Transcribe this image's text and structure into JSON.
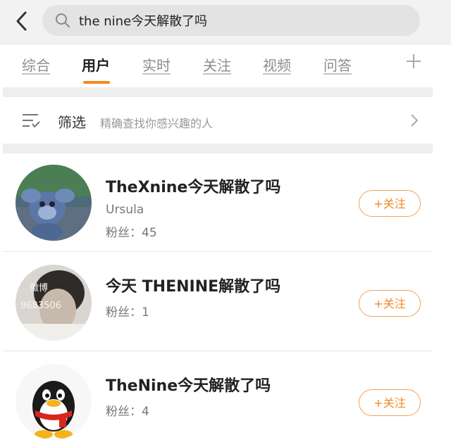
{
  "search": {
    "query": "the nine今天解散了吗"
  },
  "icons": {
    "back": "back-arrow-icon",
    "search": "search-icon",
    "add_tab": "plus-icon",
    "filter": "filter-icon",
    "chevron": "chevron-right-icon"
  },
  "tabs": [
    {
      "label": "综合"
    },
    {
      "label": "用户"
    },
    {
      "label": "实时"
    },
    {
      "label": "关注"
    },
    {
      "label": "视频"
    },
    {
      "label": "问答"
    }
  ],
  "filter": {
    "label": "筛选",
    "hint": "精确查找你感兴趣的人"
  },
  "users": [
    {
      "name": "TheXnine今天解散了吗",
      "subtitle": "Ursula",
      "fans": "粉丝：45",
      "follow": "+关注"
    },
    {
      "name": "今天 THENINE解散了吗",
      "fans": "粉丝：1",
      "follow": "+关注",
      "avatar_text": [
        "徽博",
        "9683506"
      ]
    },
    {
      "name": "TheNine今天解散了吗",
      "fans": "粉丝：4",
      "follow": "+关注"
    }
  ],
  "colors": {
    "accent": "#f28a1f",
    "background": "#f2f2f2"
  }
}
